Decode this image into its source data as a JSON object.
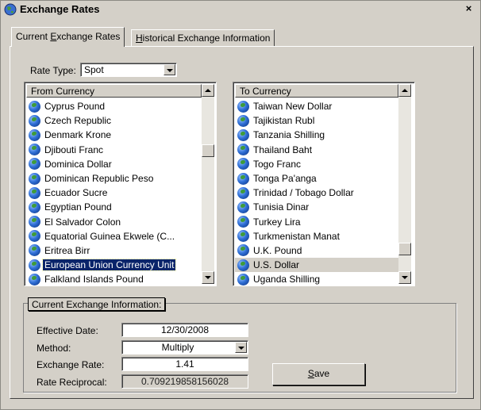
{
  "window": {
    "title": "Exchange Rates",
    "close_glyph": "×"
  },
  "tabs": [
    {
      "pre": "Current ",
      "accel": "E",
      "post": "xchange Rates"
    },
    {
      "pre": "",
      "accel": "H",
      "post": "istorical Exchange Information"
    }
  ],
  "rate_type": {
    "label": "Rate Type:",
    "value": "Spot"
  },
  "from_list": {
    "header": "From Currency",
    "items": [
      "Cyprus Pound",
      "Czech Republic",
      "Denmark Krone",
      "Djibouti Franc",
      "Dominica Dollar",
      "Dominican Republic Peso",
      "Ecuador Sucre",
      "Egyptian Pound",
      "El Salvador Colon",
      "Equatorial Guinea Ekwele (C...",
      "Eritrea Birr",
      "European Union Currency Unit",
      "Falkland Islands Pound"
    ],
    "selected": "European Union Currency Unit"
  },
  "to_list": {
    "header": "To Currency",
    "items": [
      "Taiwan New Dollar",
      "Tajikistan Rubl",
      "Tanzania Shilling",
      "Thailand Baht",
      "Togo Franc",
      "Tonga Pa'anga",
      "Trinidad / Tobago Dollar",
      "Tunisia Dinar",
      "Turkey Lira",
      "Turkmenistan Manat",
      "U.K. Pound",
      "U.S. Dollar",
      "Uganda Shilling"
    ],
    "selected": "U.S. Dollar"
  },
  "exchange_info": {
    "group_label": "Current Exchange Information:",
    "effective_date_label": "Effective Date:",
    "effective_date": "12/30/2008",
    "method_label": "Method:",
    "method": "Multiply",
    "exchange_rate_label": "Exchange Rate:",
    "exchange_rate": "1.41",
    "reciprocal_label": "Rate Reciprocal:",
    "reciprocal": "0.709219858156028"
  },
  "save_button": {
    "accel": "S",
    "post": "ave"
  },
  "icons": {
    "app": "currency-globe-icon",
    "list_item": "globe-icon",
    "close": "close-icon"
  }
}
